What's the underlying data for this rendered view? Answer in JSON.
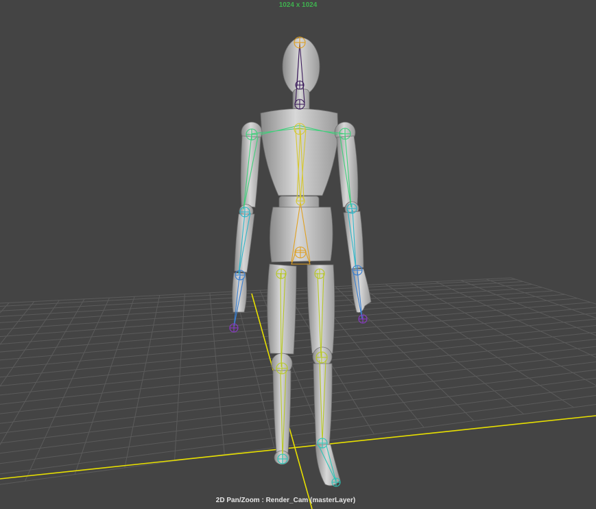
{
  "viewport": {
    "resolution_gate": "1024 x 1024",
    "camera_label": "2D Pan/Zoom : Render_Cam (masterLayer)"
  },
  "colors": {
    "background": "#444444",
    "grid": "#5b5b5b",
    "grid_axis": "#e8e000",
    "joint_root": "#e0a020",
    "joint_spine": "#d6c830",
    "joint_neck_head": "#3a1a5a",
    "joint_arm": "#3fcf7a",
    "joint_forearm": "#2fb6c8",
    "joint_hand": "#3a7fd0",
    "joint_finger": "#8a3ac8",
    "joint_leg": "#b8c826",
    "joint_foot": "#2cc6b8",
    "mesh": "#c9c9c9"
  },
  "icons": [
    "joint-icon"
  ]
}
